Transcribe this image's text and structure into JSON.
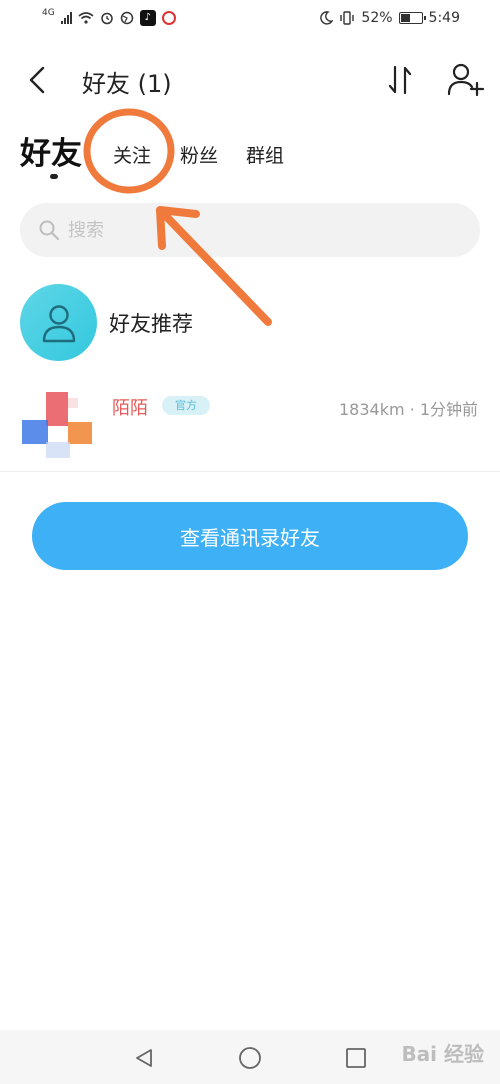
{
  "status_bar": {
    "network": "4G",
    "battery_percent": "52%",
    "battery_level": 0.52,
    "time": "5:49"
  },
  "header": {
    "title": "好友 (1)"
  },
  "tabs": [
    {
      "label": "好友",
      "active": true
    },
    {
      "label": "关注",
      "active": false
    },
    {
      "label": "粉丝",
      "active": false
    },
    {
      "label": "群组",
      "active": false
    }
  ],
  "search": {
    "placeholder": "搜索"
  },
  "recommend": {
    "label": "好友推荐"
  },
  "friends": [
    {
      "name": "陌陌",
      "badge": "官方",
      "meta": "1834km · 1分钟前"
    }
  ],
  "contacts_button": {
    "label": "查看通讯录好友"
  },
  "watermark": "Bai 经验",
  "colors": {
    "accent": "#3eb0f5",
    "recommend_avatar": "#3ccbe0",
    "annotation": "#f07a3c"
  }
}
